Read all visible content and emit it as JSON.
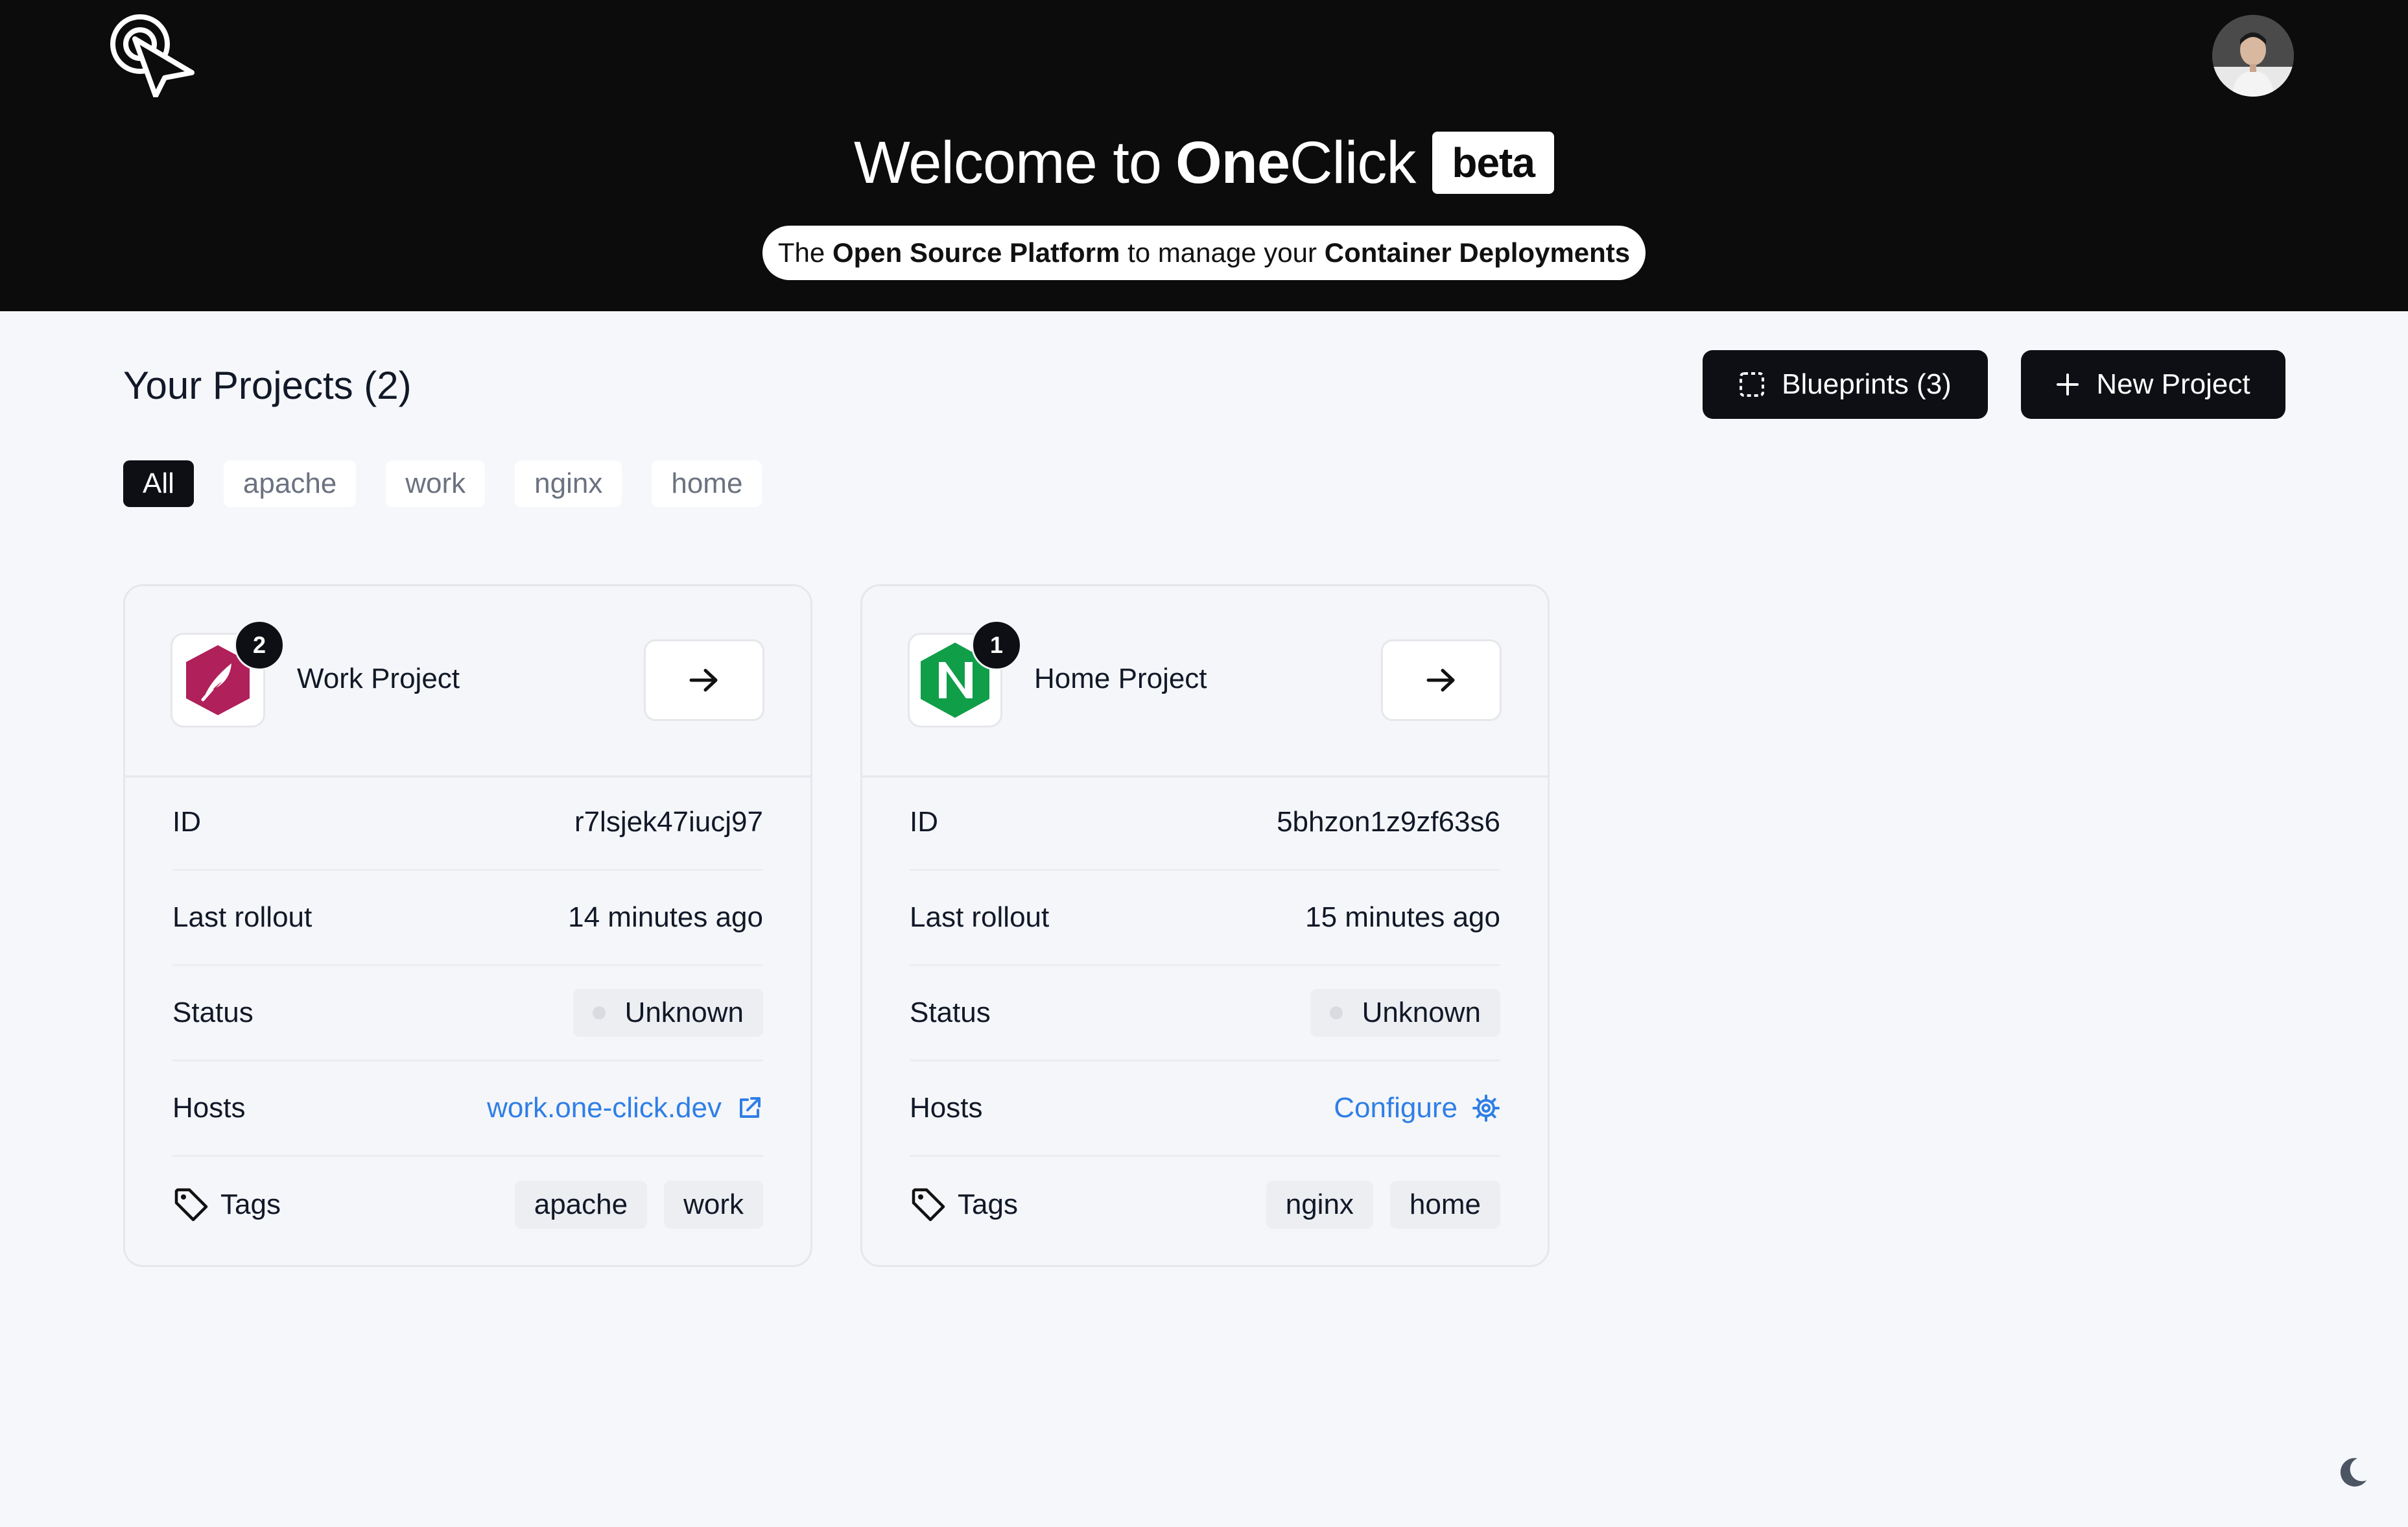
{
  "header": {
    "title_prefix": "Welcome to",
    "brand_strong": "One",
    "brand_rest": "Click",
    "badge": "beta",
    "tagline": {
      "t1": "The",
      "t2": "Open Source Platform",
      "t3": "to manage your",
      "t4": "Container Deployments"
    }
  },
  "projects": {
    "title": "Your Projects (2)",
    "blueprints_label": "Blueprints (3)",
    "new_project_label": "New Project",
    "filters": [
      "All",
      "apache",
      "work",
      "nginx",
      "home"
    ]
  },
  "labels": {
    "id": "ID",
    "last_rollout": "Last rollout",
    "status": "Status",
    "hosts": "Hosts",
    "tags": "Tags"
  },
  "cards": [
    {
      "name": "Work Project",
      "count": "2",
      "icon": "apache-feather-icon",
      "id": "r7lsjek47iucj97",
      "last_rollout": "14 minutes ago",
      "status": "Unknown",
      "hosts": "work.one-click.dev",
      "tags": [
        "apache",
        "work"
      ]
    },
    {
      "name": "Home Project",
      "count": "1",
      "icon": "nginx-icon",
      "id": "5bhzon1z9zf63s6",
      "last_rollout": "15 minutes ago",
      "status": "Unknown",
      "hosts": "Configure",
      "tags": [
        "nginx",
        "home"
      ]
    }
  ],
  "colors": {
    "header_bg": "#0c0c0c",
    "page_bg": "#f6f7fb",
    "link": "#2f7fe6",
    "apache_magenta": "#b0205a",
    "nginx_green": "#119e49"
  }
}
